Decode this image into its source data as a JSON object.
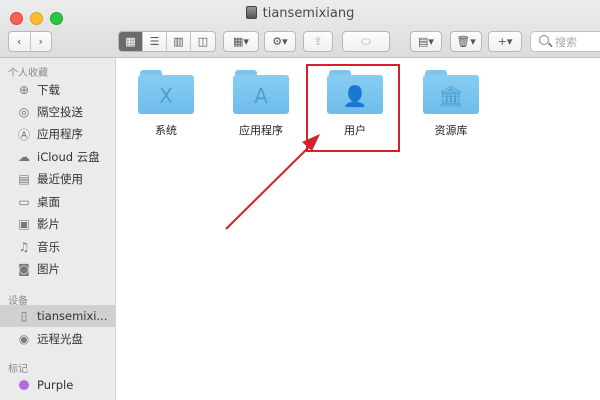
{
  "window": {
    "title": "tiansemixiang"
  },
  "toolbar": {
    "back_icon": "chevron-left-icon",
    "forward_icon": "chevron-right-icon",
    "view_modes": [
      "icon-view-icon",
      "list-view-icon",
      "column-view-icon",
      "gallery-view-icon"
    ],
    "group_icon": "group-by-icon",
    "action_icon": "gear-icon",
    "share_icon": "share-icon",
    "tag_icon": "tag-icon",
    "add_label": "+",
    "search_placeholder": "搜索"
  },
  "sidebar": {
    "favorites_header": "个人收藏",
    "favorites": [
      {
        "label": "下载",
        "icon": "download-icon"
      },
      {
        "label": "隔空投送",
        "icon": "airdrop-icon"
      },
      {
        "label": "应用程序",
        "icon": "applications-icon"
      },
      {
        "label": "iCloud 云盘",
        "icon": "icloud-icon"
      },
      {
        "label": "最近使用",
        "icon": "recents-icon"
      },
      {
        "label": "桌面",
        "icon": "desktop-icon"
      },
      {
        "label": "影片",
        "icon": "movies-icon"
      },
      {
        "label": "音乐",
        "icon": "music-icon"
      },
      {
        "label": "图片",
        "icon": "pictures-icon"
      }
    ],
    "devices_header": "设备",
    "devices": [
      {
        "label": "tiansemixi...",
        "icon": "disk-icon",
        "selected": true
      },
      {
        "label": "远程光盘",
        "icon": "remote-disc-icon"
      }
    ],
    "tags_header": "标记",
    "tags": [
      {
        "label": "Purple",
        "color": "#b36ae2"
      }
    ]
  },
  "content": {
    "items": [
      {
        "label": "系统",
        "icon": "system-folder-icon",
        "glyph": "X"
      },
      {
        "label": "应用程序",
        "icon": "applications-folder-icon",
        "glyph": "A"
      },
      {
        "label": "用户",
        "icon": "users-folder-icon",
        "glyph": "👤"
      },
      {
        "label": "资源库",
        "icon": "library-folder-icon",
        "glyph": "🏛"
      }
    ],
    "annotation_color": "#d4212a"
  }
}
